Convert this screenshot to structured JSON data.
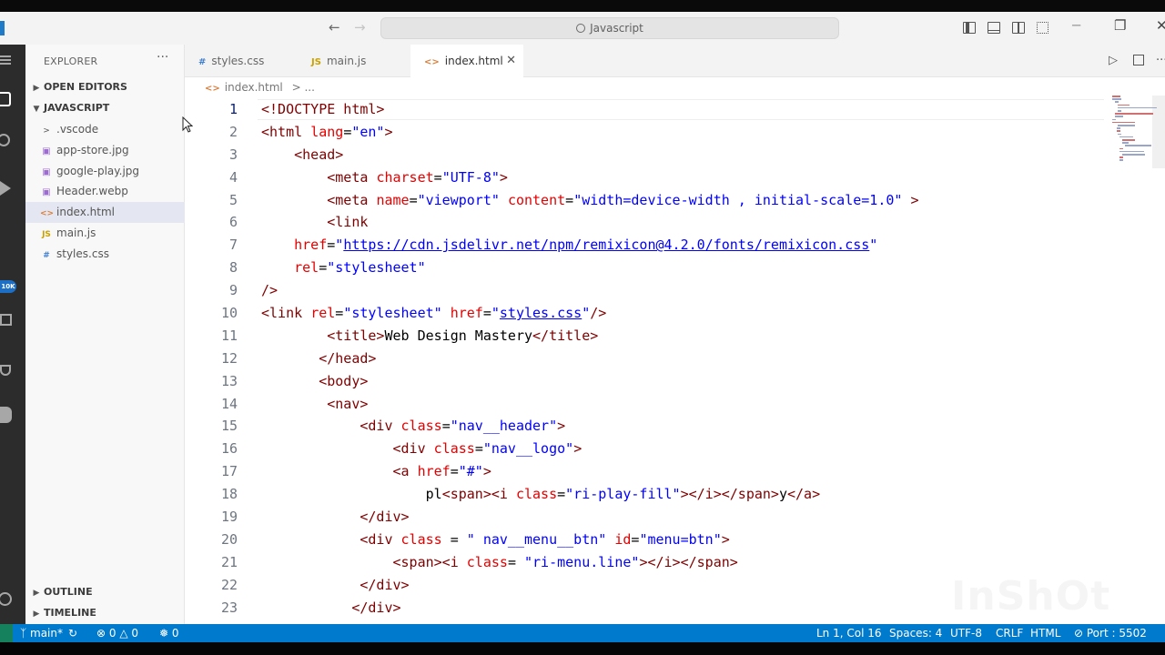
{
  "titlebar": {
    "search_text": "Javascript",
    "back_glyph": "←",
    "forward_glyph": "→",
    "minimize_glyph": "─",
    "restore_glyph": "❐",
    "close_glyph": "✕"
  },
  "activity": {
    "badge": "10K"
  },
  "explorer": {
    "title": "EXPLORER",
    "more": "···",
    "open_editors": "OPEN EDITORS",
    "folder": "JAVASCRIPT",
    "items": [
      {
        "label": ".vscode",
        "icon": ">",
        "type": "folder"
      },
      {
        "label": "app-store.jpg",
        "icon": "▣",
        "type": "image"
      },
      {
        "label": "google-play.jpg",
        "icon": "▣",
        "type": "image"
      },
      {
        "label": "Header.webp",
        "icon": "▣",
        "type": "image"
      },
      {
        "label": "index.html",
        "icon": "<>",
        "type": "html",
        "selected": true
      },
      {
        "label": "main.js",
        "icon": "JS",
        "type": "js"
      },
      {
        "label": "styles.css",
        "icon": "#",
        "type": "css"
      }
    ],
    "outline": "OUTLINE",
    "timeline": "TIMELINE"
  },
  "tabs": [
    {
      "icon": "#",
      "label": "styles.css"
    },
    {
      "icon": "JS",
      "label": "main.js"
    },
    {
      "icon": "<>",
      "label": "index.html",
      "active": true,
      "close": "✕"
    }
  ],
  "editor": {
    "breadcrumb_icon": "<>",
    "breadcrumb": "index.html",
    "breadcrumb_rest": ">  ...",
    "current_line": 1,
    "lines": [
      {
        "n": "1",
        "tokens": [
          [
            "tg",
            "<!DOCTYPE html>"
          ]
        ]
      },
      {
        "n": "2",
        "tokens": [
          [
            "tg",
            "<html "
          ],
          [
            "at",
            "lang"
          ],
          [
            "tx",
            "="
          ],
          [
            "st",
            "\"en\""
          ],
          [
            "tg",
            ">"
          ]
        ]
      },
      {
        "n": "3",
        "tokens": [
          [
            "tg",
            "    <head>"
          ]
        ]
      },
      {
        "n": "4",
        "tokens": [
          [
            "tg",
            "        <meta "
          ],
          [
            "at",
            "charset"
          ],
          [
            "tx",
            "="
          ],
          [
            "st",
            "\"UTF-8\""
          ],
          [
            "tg",
            ">"
          ]
        ]
      },
      {
        "n": "5",
        "tokens": [
          [
            "tg",
            "        <meta "
          ],
          [
            "at",
            "name"
          ],
          [
            "tx",
            "="
          ],
          [
            "st",
            "\"viewport\" "
          ],
          [
            "at",
            "content"
          ],
          [
            "tx",
            "="
          ],
          [
            "st",
            "\"width=device-width , initial-scale=1.0\""
          ],
          [
            "tg",
            " >"
          ]
        ]
      },
      {
        "n": "6",
        "tokens": [
          [
            "tg",
            "        <link"
          ]
        ]
      },
      {
        "n": "7",
        "tokens": [
          [
            "at",
            "    href"
          ],
          [
            "tx",
            "="
          ],
          [
            "st",
            "\""
          ],
          [
            "lnk",
            "https://cdn.jsdelivr.net/npm/remixicon@4.2.0/fonts/remixicon.css"
          ],
          [
            "st",
            "\""
          ]
        ]
      },
      {
        "n": "8",
        "tokens": [
          [
            "at",
            "    rel"
          ],
          [
            "tx",
            "="
          ],
          [
            "st",
            "\"stylesheet\""
          ]
        ]
      },
      {
        "n": "9",
        "tokens": [
          [
            "tg",
            "/>"
          ]
        ]
      },
      {
        "n": "10",
        "tokens": [
          [
            "tg",
            "<link "
          ],
          [
            "at",
            "rel"
          ],
          [
            "tx",
            "="
          ],
          [
            "st",
            "\"stylesheet\" "
          ],
          [
            "at",
            "href"
          ],
          [
            "tx",
            "="
          ],
          [
            "st",
            "\""
          ],
          [
            "lnk",
            "styles.css"
          ],
          [
            "st",
            "\""
          ],
          [
            "tg",
            "/>"
          ]
        ]
      },
      {
        "n": "11",
        "tokens": [
          [
            "tg",
            "        <title>"
          ],
          [
            "tx",
            "Web Design Mastery"
          ],
          [
            "tg",
            "</title>"
          ]
        ]
      },
      {
        "n": "12",
        "tokens": [
          [
            "tg",
            "       </head>"
          ]
        ]
      },
      {
        "n": "13",
        "tokens": [
          [
            "tg",
            "       <body>"
          ]
        ]
      },
      {
        "n": "14",
        "tokens": [
          [
            "tg",
            "        <nav>"
          ]
        ]
      },
      {
        "n": "15",
        "tokens": [
          [
            "tg",
            "            <div "
          ],
          [
            "at",
            "class"
          ],
          [
            "tx",
            "="
          ],
          [
            "st",
            "\"nav__header\""
          ],
          [
            "tg",
            ">"
          ]
        ]
      },
      {
        "n": "16",
        "tokens": [
          [
            "tg",
            "                <div "
          ],
          [
            "at",
            "class"
          ],
          [
            "tx",
            "="
          ],
          [
            "st",
            "\"nav__logo\""
          ],
          [
            "tg",
            ">"
          ]
        ]
      },
      {
        "n": "17",
        "tokens": [
          [
            "tg",
            "                <a "
          ],
          [
            "at",
            "href"
          ],
          [
            "tx",
            "="
          ],
          [
            "st",
            "\"#\""
          ],
          [
            "tg",
            ">"
          ]
        ]
      },
      {
        "n": "18",
        "tokens": [
          [
            "tx",
            "                    pl"
          ],
          [
            "tg",
            "<span><i "
          ],
          [
            "at",
            "class"
          ],
          [
            "tx",
            "="
          ],
          [
            "st",
            "\"ri-play-fill\""
          ],
          [
            "tg",
            "></i></span>"
          ],
          [
            "tx",
            "y"
          ],
          [
            "tg",
            "</a>"
          ]
        ]
      },
      {
        "n": "19",
        "tokens": [
          [
            "tg",
            "            </div>"
          ]
        ]
      },
      {
        "n": "20",
        "tokens": [
          [
            "tg",
            "            <div "
          ],
          [
            "at",
            "class"
          ],
          [
            "tx",
            " = "
          ],
          [
            "st",
            "\" nav__menu__btn\" "
          ],
          [
            "at",
            "id"
          ],
          [
            "tx",
            "="
          ],
          [
            "st",
            "\"menu=btn\""
          ],
          [
            "tg",
            ">"
          ]
        ]
      },
      {
        "n": "21",
        "tokens": [
          [
            "tg",
            "                <span><i "
          ],
          [
            "at",
            "class"
          ],
          [
            "tx",
            "= "
          ],
          [
            "st",
            "\"ri-menu.line\""
          ],
          [
            "tg",
            "></i></span>"
          ]
        ]
      },
      {
        "n": "22",
        "tokens": [
          [
            "tg",
            "            </div>"
          ]
        ]
      },
      {
        "n": "23",
        "tokens": [
          [
            "tg",
            "           </div>"
          ]
        ]
      }
    ]
  },
  "status": {
    "branch": "main*",
    "errors": "0",
    "warnings": "0",
    "ports": "0",
    "position": "Ln 1, Col 16",
    "spaces": "Spaces: 4",
    "encoding": "UTF-8",
    "eol": "CRLF",
    "language": "HTML",
    "port": "Port : 5502"
  },
  "watermark": "InShOt",
  "colors": {
    "statusbar": "#007acc",
    "tag": "#800000",
    "attribute": "#e50000",
    "string": "#0000ff"
  }
}
